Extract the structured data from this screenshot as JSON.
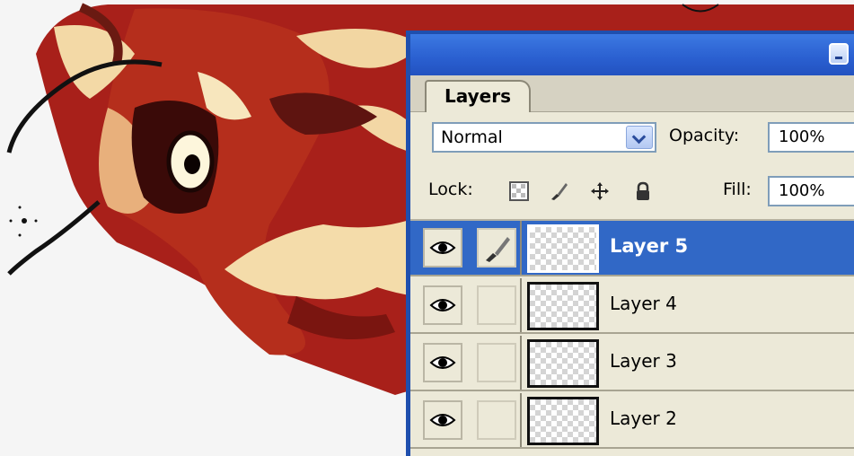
{
  "panel": {
    "tab_label": "Layers",
    "blend_mode": "Normal",
    "opacity_label": "Opacity:",
    "opacity_value": "100%",
    "lock_label": "Lock:",
    "fill_label": "Fill:",
    "fill_value": "100%"
  },
  "layers": [
    {
      "name": "Layer 5",
      "visible": true,
      "selected": true,
      "brush_active": true
    },
    {
      "name": "Layer 4",
      "visible": true,
      "selected": false,
      "brush_active": false
    },
    {
      "name": "Layer 3",
      "visible": true,
      "selected": false,
      "brush_active": false
    },
    {
      "name": "Layer 2",
      "visible": true,
      "selected": false,
      "brush_active": false
    }
  ],
  "colors": {
    "titlebar": "#2a5fd0",
    "selection": "#3168c6",
    "panel_bg": "#ece9d8",
    "artwork_red": "#9a1a10",
    "artwork_cream": "#f6e4b8"
  }
}
